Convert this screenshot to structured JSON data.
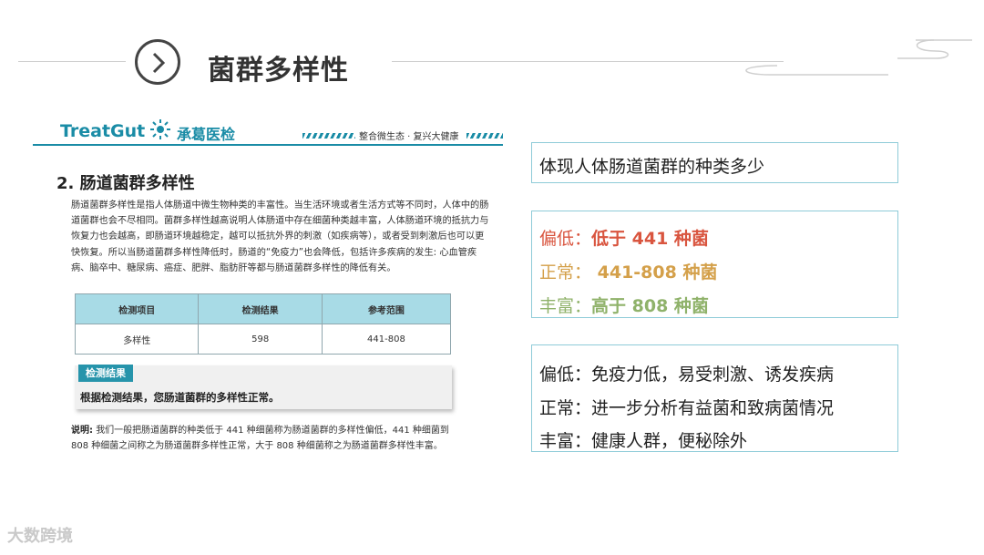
{
  "header": {
    "title": "菌群多样性"
  },
  "report": {
    "logo_en": "TreatGut",
    "logo_cn": "承葛医检",
    "slogan": "整合微生态 · 复兴大健康",
    "heading": "2. 肠道菌群多样性",
    "body": "肠道菌群多样性是指人体肠道中微生物种类的丰富性。当生活环境或者生活方式等不同时，人体中的肠道菌群也会不尽相同。菌群多样性越高说明人体肠道中存在细菌种类越丰富，人体肠道环境的抵抗力与恢复力也会越高，即肠道环境越稳定，越可以抵抗外界的刺激（如疾病等），或者受到刺激后也可以更快恢复。所以当肠道菌群多样性降低时，肠道的“免疫力”也会降低，包括许多疾病的发生: 心血管疾病、脑卒中、糖尿病、癌症、肥胖、脂肪肝等都与肠道菌群多样性的降低有关。",
    "table": {
      "headers": [
        "检测项目",
        "检测结果",
        "参考范围"
      ],
      "row": [
        "多样性",
        "598",
        "441-808"
      ]
    },
    "result_tag": "检测结果",
    "result_text": "根据检测结果，您肠道菌群的多样性正常。",
    "note_label": "说明:",
    "note_text": "我们一般把肠道菌群的种类低于 441 种细菌称为肠道菌群的多样性偏低，441 种细菌到 808 种细菌之间称之为肠道菌群多样性正常，大于 808 种细菌称之为肠道菌群多样性丰富。"
  },
  "summary": {
    "line": "体现人体肠道菌群的种类多少"
  },
  "levels": [
    {
      "label": "偏低：",
      "value": "低于 441 种菌",
      "color": "#d9553f"
    },
    {
      "label": "正常：",
      "value": " 441-808 种菌",
      "color": "#d4a04a"
    },
    {
      "label": "丰富：",
      "value": "高于 808 种菌",
      "color": "#8fb26a"
    }
  ],
  "meanings": [
    "偏低：免疫力低，易受刺激、诱发疾病",
    "正常：进一步分析有益菌和致病菌情况",
    "丰富：健康人群，便秘除外"
  ],
  "watermark": "大数跨境"
}
